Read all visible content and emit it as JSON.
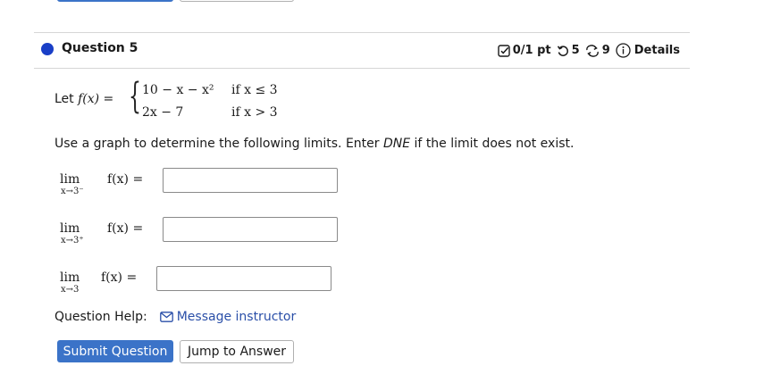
{
  "question": {
    "title": "Question 5",
    "score": "0/1 pt",
    "retries": "5",
    "attempts": "9",
    "details_label": "Details"
  },
  "function": {
    "let_label": "Let",
    "lhs": "f(x) =",
    "case1_expr": "10 − x − x²",
    "case1_cond": "if  x ≤ 3",
    "case2_expr": "2x − 7",
    "case2_cond": "if  x > 3"
  },
  "instructions": {
    "before": "Use a graph to determine the following limits. Enter ",
    "emphasis": "DNE",
    "after": " if the limit does not exist."
  },
  "limits": [
    {
      "word": "lim",
      "sub": "x→3⁻",
      "expr": "f(x) =",
      "value": ""
    },
    {
      "word": "lim",
      "sub": "x→3⁺",
      "expr": "f(x) =",
      "value": ""
    },
    {
      "word": "lim",
      "sub": "x→3",
      "expr": "f(x) =",
      "value": ""
    }
  ],
  "help": {
    "label": "Question Help:",
    "message_link": "Message instructor"
  },
  "buttons": {
    "submit": "Submit Question",
    "jump": "Jump to Answer"
  },
  "colors": {
    "accent": "#3b73c8",
    "dot": "#1a3fc7",
    "link": "#2a4fa8"
  }
}
